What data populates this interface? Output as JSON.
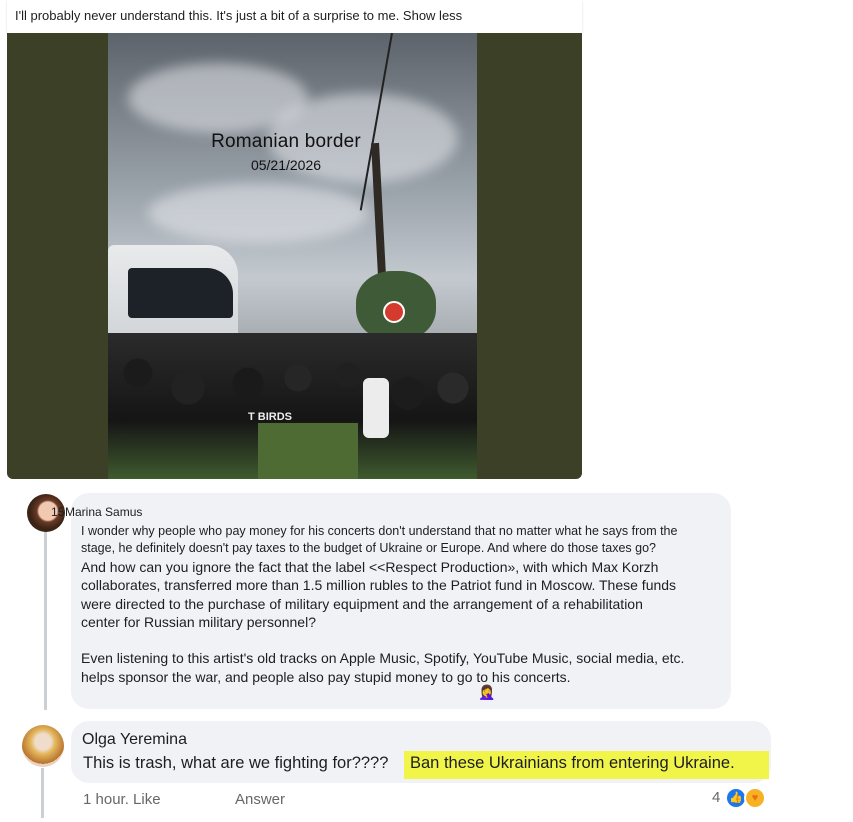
{
  "post": {
    "caption": "I'll probably never understand this. It's just a bit of a surprise to me. Show less",
    "image_title": "Romanian border",
    "image_date": "05/21/2026",
    "shirt_text": "T BIRDS"
  },
  "comment1": {
    "rank": "15",
    "author": "Marina Samus",
    "lines": [
      "I wonder why people who pay money for his concerts don't understand that no matter what he says from the",
      "stage, he definitely doesn't pay taxes to the budget of Ukraine or Europe. And where do those taxes go?",
      "And how can you ignore the fact that the label <<Respect Production», with which Max Korzh",
      "collaborates, transferred more than 1.5 million rubles to the Patriot fund in Moscow. These funds",
      "were directed to the purchase of military equipment and the arrangement of a rehabilitation",
      "center for Russian military personnel?",
      "Even listening to this artist's old tracks on Apple Music, Spotify, YouTube Music, social media, etc.",
      "helps sponsor the war, and people also pay stupid money to go to his concerts."
    ],
    "emoji": "🤦‍♀️"
  },
  "comment2": {
    "author": "Olga Yeremina",
    "text_plain": "This is trash, what are we fighting for????",
    "text_highlighted": "Ban these Ukrainians from entering Ukraine.",
    "time_like": "1 hour. Like",
    "answer": "Answer",
    "reaction_count": "4",
    "reaction_icons": [
      "like-icon",
      "care-icon"
    ]
  },
  "colors": {
    "bubble": "#f0f2f5",
    "highlight": "#f2f549",
    "meta_text": "#65676b",
    "photo_border": "#3b4027",
    "like_blue": "#1877f2"
  }
}
